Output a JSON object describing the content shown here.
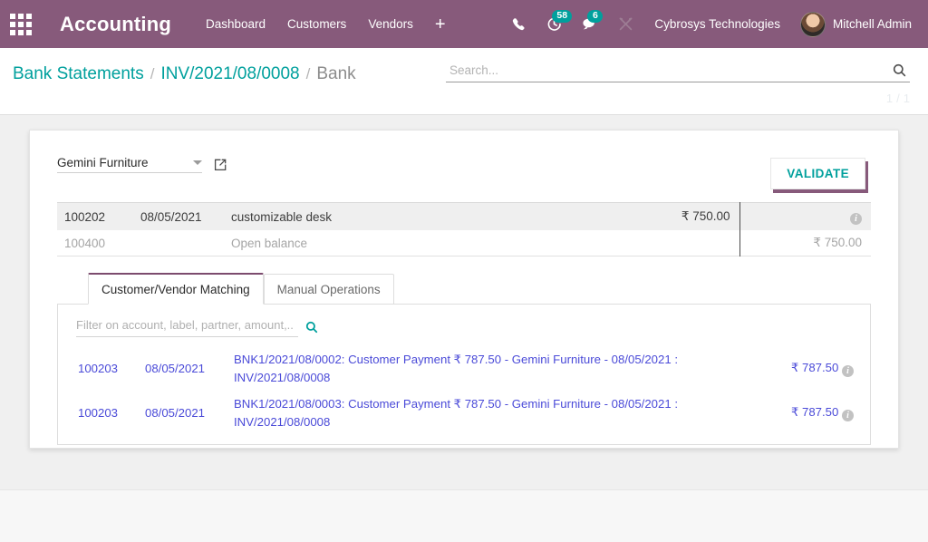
{
  "navbar": {
    "apps_icon": "apps-grid-icon",
    "brand": "Accounting",
    "menu": [
      {
        "label": "Dashboard"
      },
      {
        "label": "Customers"
      },
      {
        "label": "Vendors"
      }
    ],
    "plus_label": "+",
    "systray": [
      {
        "name": "phone-icon",
        "badge": null
      },
      {
        "name": "activity-clock-icon",
        "badge": "58"
      },
      {
        "name": "messages-chat-icon",
        "badge": "6"
      },
      {
        "name": "tools-wrench-icon",
        "badge": null
      }
    ],
    "company": "Cybrosys Technologies",
    "user": "Mitchell Admin",
    "accent_color": "#875a7b",
    "badge_color": "#00a09d"
  },
  "control_panel": {
    "breadcrumb": [
      {
        "label": "Bank Statements",
        "active": false
      },
      {
        "label": "INV/2021/08/0008",
        "active": false
      },
      {
        "label": "Bank",
        "active": true
      }
    ],
    "separator": "/",
    "search": {
      "value": "",
      "placeholder": "Search...",
      "icon": "search-icon"
    },
    "pager": {
      "current": "1",
      "separator": "/",
      "total": "1"
    }
  },
  "reconciliation": {
    "partner": {
      "value": "Gemini Furniture",
      "caret_icon": "chevron-down-icon",
      "external_link_icon": "external-link-icon"
    },
    "validate_label": "VALIDATE",
    "statement_lines": [
      {
        "account": "100202",
        "date": "08/05/2021",
        "label": "customizable desk",
        "amount": "₹ 750.00",
        "matched_amount": "",
        "info_icon": "info-icon",
        "muted": false
      },
      {
        "account": "100400",
        "date": "",
        "label": "Open balance",
        "amount": "",
        "matched_amount": "₹ 750.00",
        "info_icon": "",
        "muted": true
      }
    ],
    "tabs": [
      {
        "label": "Customer/Vendor Matching",
        "active": true
      },
      {
        "label": "Manual Operations",
        "active": false
      }
    ],
    "filter": {
      "value": "",
      "placeholder": "Filter on account, label, partner, amount,..",
      "icon": "search-icon"
    },
    "match_rows": [
      {
        "account": "100203",
        "date": "08/05/2021",
        "label": "BNK1/2021/08/0002: Customer Payment ₹ 787.50 - Gemini Furniture - 08/05/2021 : INV/2021/08/0008",
        "amount": "₹ 787.50",
        "info_icon": "info-icon"
      },
      {
        "account": "100203",
        "date": "08/05/2021",
        "label": "BNK1/2021/08/0003: Customer Payment ₹ 787.50 - Gemini Furniture - 08/05/2021 : INV/2021/08/0008",
        "amount": "₹ 787.50",
        "info_icon": "info-icon"
      }
    ]
  }
}
